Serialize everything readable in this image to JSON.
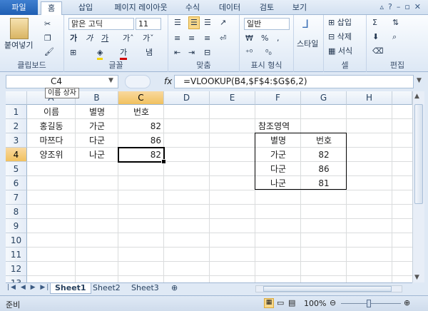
{
  "tabs": {
    "file": "파일",
    "home": "홈",
    "insert": "삽입",
    "layout": "페이지 레이아웃",
    "formulas": "수식",
    "data": "데이터",
    "review": "검토",
    "view": "보기"
  },
  "ribbon": {
    "clipboard": {
      "paste": "붙여넣기",
      "label": "클립보드"
    },
    "font": {
      "name": "맑은 고딕",
      "size": "11",
      "label": "글꼴"
    },
    "align": {
      "label": "맞춤"
    },
    "number": {
      "format": "일반",
      "label": "표시 형식"
    },
    "style": {
      "styles": "스타일"
    },
    "cells": {
      "insert": "삽입",
      "delete": "삭제",
      "format": "서식",
      "label": "셀"
    },
    "editing": {
      "label": "편집"
    }
  },
  "formula": {
    "namebox": "C4",
    "tooltip": "이름 상자",
    "fx": "fx",
    "content": "=VLOOKUP(B4,$F$4:$G$6,2)"
  },
  "columns": [
    "A",
    "B",
    "C",
    "D",
    "E",
    "F",
    "G",
    "H"
  ],
  "rows": [
    "1",
    "2",
    "3",
    "4",
    "5",
    "6",
    "7",
    "8",
    "9",
    "10",
    "11",
    "12",
    "13"
  ],
  "cells": {
    "a1": "이름",
    "b1": "별명",
    "c1": "번호",
    "a2": "홍길동",
    "b2": "가군",
    "c2": "82",
    "a3": "마쯔다",
    "b3": "다군",
    "c3": "86",
    "a4": "양조위",
    "b4": "나군",
    "c4": "82",
    "f2": "참조영역",
    "f3": "별명",
    "g3": "번호",
    "f4": "가군",
    "g4": "82",
    "f5": "다군",
    "g5": "86",
    "f6": "나군",
    "g6": "81"
  },
  "sheets": [
    "Sheet1",
    "Sheet2",
    "Sheet3"
  ],
  "status": {
    "ready": "준비",
    "zoom": "100%"
  }
}
